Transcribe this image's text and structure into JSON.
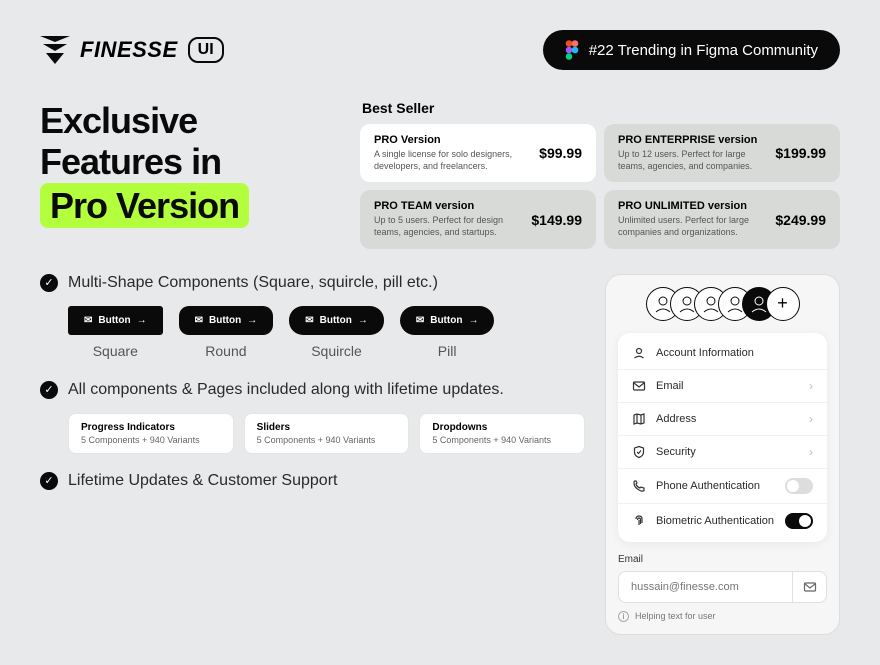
{
  "brand": {
    "name": "FINESSE",
    "suffix": "UI"
  },
  "trending": "#22 Trending in Figma Community",
  "headline": {
    "line1": "Exclusive",
    "line2": "Features in",
    "highlight": "Pro Version"
  },
  "best_seller_label": "Best Seller",
  "pricing": [
    {
      "title": "PRO Version",
      "desc": "A single license for solo designers, developers, and freelancers.",
      "price": "$99.99",
      "featured": true
    },
    {
      "title": "PRO ENTERPRISE version",
      "desc": "Up to 12 users. Perfect for large teams, agencies, and companies.",
      "price": "$199.99",
      "featured": false
    },
    {
      "title": "PRO TEAM version",
      "desc": "Up to 5 users. Perfect for design teams, agencies, and startups.",
      "price": "$149.99",
      "featured": false
    },
    {
      "title": "PRO UNLIMITED version",
      "desc": "Unlimited users. Perfect for large companies and organizations.",
      "price": "$249.99",
      "featured": false
    }
  ],
  "features": {
    "shapes_heading": "Multi-Shape Components (Square, squircle, pill etc.)",
    "components_heading": "All components & Pages included along with lifetime updates.",
    "support_heading": "Lifetime Updates & Customer Support"
  },
  "button_label": "Button",
  "shapes": [
    {
      "label": "Square"
    },
    {
      "label": "Round"
    },
    {
      "label": "Squircle"
    },
    {
      "label": "Pill"
    }
  ],
  "stats": [
    {
      "title": "Progress Indicators",
      "sub": "5 Components + 940 Variants"
    },
    {
      "title": "Sliders",
      "sub": "5 Components + 940 Variants"
    },
    {
      "title": "Dropdowns",
      "sub": "5 Components + 940 Variants"
    }
  ],
  "menu": {
    "items": [
      {
        "label": "Account Information"
      },
      {
        "label": "Email"
      },
      {
        "label": "Address"
      },
      {
        "label": "Security"
      },
      {
        "label": "Phone Authentication"
      },
      {
        "label": "Biometric Authentication"
      }
    ]
  },
  "email_form": {
    "label": "Email",
    "placeholder": "hussain@finesse.com",
    "help": "Helping text for user"
  }
}
